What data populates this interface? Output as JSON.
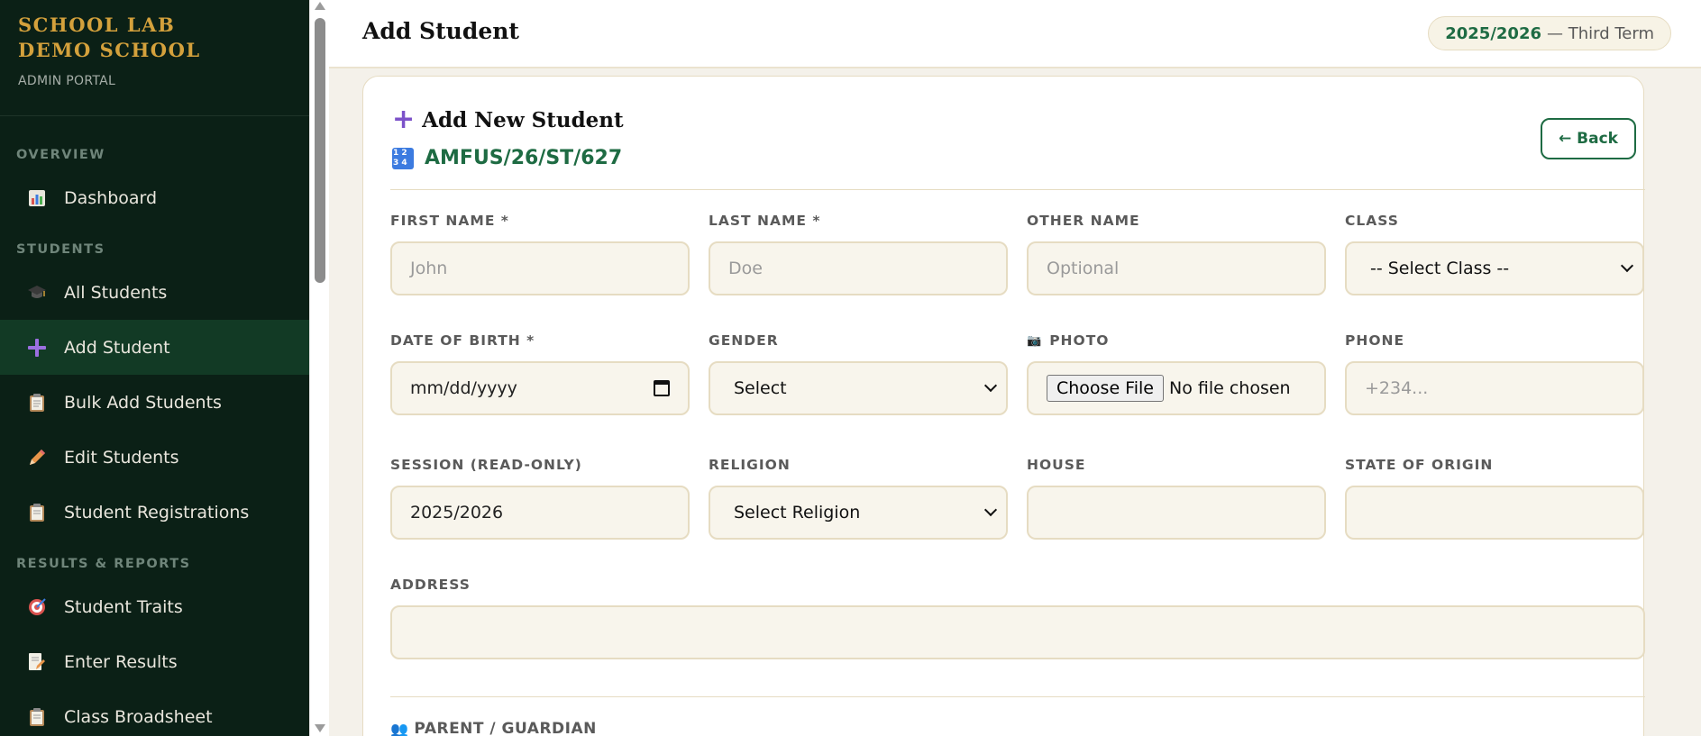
{
  "sidebar": {
    "brand_line1": "SCHOOL LAB",
    "brand_line2": "DEMO SCHOOL",
    "brand_sub": "ADMIN PORTAL",
    "sections": {
      "overview": "OVERVIEW",
      "students": "STUDENTS",
      "results": "RESULTS & REPORTS"
    },
    "items": {
      "dashboard": "Dashboard",
      "all_students": "All Students",
      "add_student": "Add Student",
      "bulk_add": "Bulk Add Students",
      "edit_students": "Edit Students",
      "registrations": "Student Registrations",
      "traits": "Student Traits",
      "enter_results": "Enter Results",
      "broadsheet": "Class Broadsheet"
    }
  },
  "header": {
    "title": "Add Student",
    "session_year": "2025/2026",
    "term": "— Third Term"
  },
  "form": {
    "title": "Add New Student",
    "student_id": "AMFUS/26/ST/627",
    "back_label": "← Back",
    "fields": {
      "first_name": {
        "label": "FIRST NAME *",
        "placeholder": "John"
      },
      "last_name": {
        "label": "LAST NAME *",
        "placeholder": "Doe"
      },
      "other_name": {
        "label": "OTHER NAME",
        "placeholder": "Optional"
      },
      "class": {
        "label": "CLASS",
        "selected": "-- Select Class --"
      },
      "dob": {
        "label": "DATE OF BIRTH *",
        "value": "mm/dd/yyyy"
      },
      "gender": {
        "label": "GENDER",
        "selected": "Select"
      },
      "photo": {
        "label": "PHOTO",
        "button": "Choose File",
        "status": "No file chosen"
      },
      "phone": {
        "label": "PHONE",
        "placeholder": "+234..."
      },
      "session": {
        "label": "SESSION (READ-ONLY)",
        "value": "2025/2026"
      },
      "religion": {
        "label": "RELIGION",
        "selected": "Select Religion"
      },
      "house": {
        "label": "HOUSE",
        "value": ""
      },
      "state_of_origin": {
        "label": "STATE OF ORIGIN",
        "value": ""
      },
      "address": {
        "label": "ADDRESS",
        "value": ""
      }
    },
    "parent_section": "PARENT / GUARDIAN"
  }
}
